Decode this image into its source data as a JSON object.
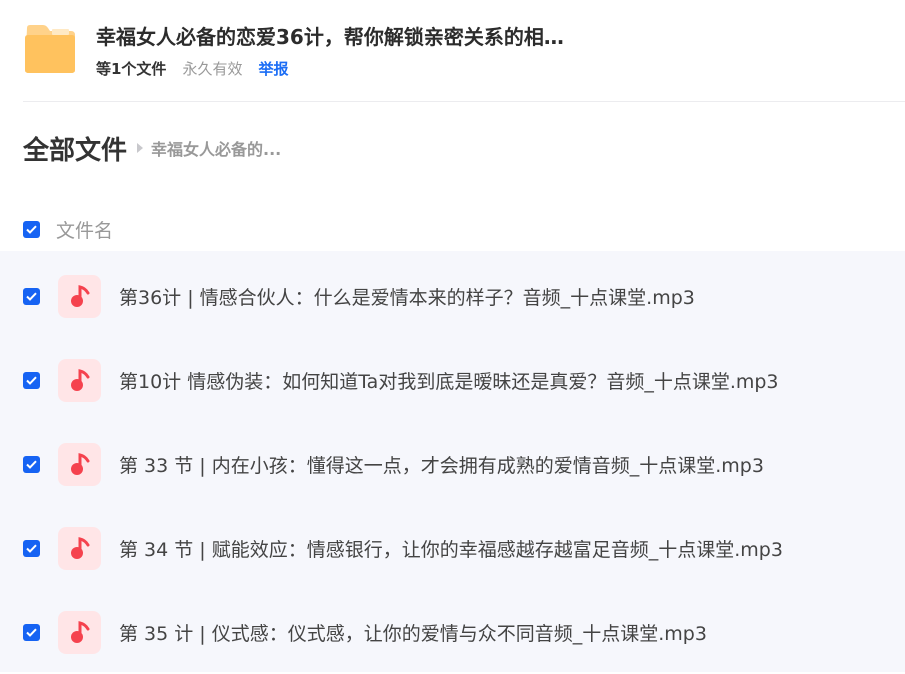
{
  "share": {
    "title": "幸福女人必备的恋爱36计，帮你解锁亲密关系的相…",
    "file_count": "等1个文件",
    "validity": "永久有效",
    "report_label": "举报"
  },
  "breadcrumb": {
    "root": "全部文件",
    "current": "幸福女人必备的..."
  },
  "list_header": {
    "column_name": "文件名"
  },
  "files": [
    {
      "name": "第36计 | 情感合伙人：什么是爱情本来的样子？音频_十点课堂.mp3",
      "icon": "music-icon"
    },
    {
      "name": "第10计 情感伪装：如何知道Ta对我到底是暧昧还是真爱？音频_十点课堂.mp3",
      "icon": "music-icon"
    },
    {
      "name": "第 33 节 | 内在小孩：懂得这一点，才会拥有成熟的爱情音频_十点课堂.mp3",
      "icon": "music-icon"
    },
    {
      "name": "第 34 节 |  赋能效应：情感银行，让你的幸福感越存越富足音频_十点课堂.mp3",
      "icon": "music-icon"
    },
    {
      "name": "第 35 计 | 仪式感：仪式感，让你的爱情与众不同音频_十点课堂.mp3",
      "icon": "music-icon"
    }
  ],
  "colors": {
    "accent": "#1663f3",
    "list_bg": "#f6f7fc",
    "audio_icon_bg": "#ffe5e7",
    "audio_icon_fg": "#f5424e",
    "folder": "#ffc96b"
  }
}
